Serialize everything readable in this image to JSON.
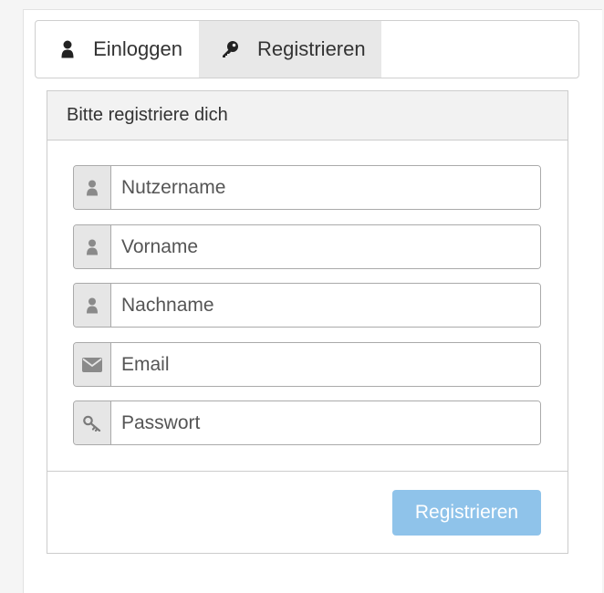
{
  "tabs": {
    "login": {
      "label": "Einloggen",
      "icon": "user-icon"
    },
    "register": {
      "label": "Registrieren",
      "icon": "key-icon",
      "active": true
    }
  },
  "panel": {
    "heading": "Bitte registriere dich",
    "fields": [
      {
        "placeholder": "Nutzername",
        "icon": "user-icon"
      },
      {
        "placeholder": "Vorname",
        "icon": "user-icon"
      },
      {
        "placeholder": "Nachname",
        "icon": "user-icon"
      },
      {
        "placeholder": "Email",
        "icon": "envelope-icon"
      },
      {
        "placeholder": "Passwort",
        "icon": "key-icon"
      }
    ],
    "submit_label": "Registrieren"
  },
  "colors": {
    "button": "#8fc3ea",
    "active_tab": "#e8e8e8",
    "addon": "#e6e6e6"
  }
}
